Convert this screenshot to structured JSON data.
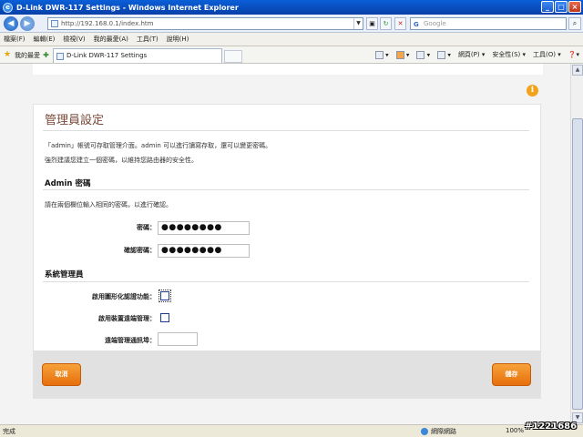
{
  "window": {
    "title": "D-Link DWR-117 Settings - Windows Internet Explorer"
  },
  "addressbar": {
    "url": "http://192.168.0.1/index.htm",
    "search_placeholder": "Google"
  },
  "menu": [
    "檔案(F)",
    "編輯(E)",
    "檢視(V)",
    "我的最愛(A)",
    "工具(T)",
    "說明(H)"
  ],
  "favorites": {
    "label": "我的最愛"
  },
  "tab": {
    "title": "D-Link DWR-117 Settings"
  },
  "commandbar": {
    "page": "網頁(P)",
    "safety": "安全性(S)",
    "tools": "工具(O)"
  },
  "page": {
    "title": "管理員設定",
    "desc1": "「admin」帳號可存取管理介面。admin 可以進行讀寫存取，還可以變更密碼。",
    "desc2": "強烈建議您建立一個密碼，以維持您路由器的安全性。",
    "admin_section": {
      "title": "Admin 密碼",
      "instruction": "請在兩個欄位輸入相同的密碼，以進行確認。",
      "password_label": "密碼：",
      "password_value": "●●●●●●●●",
      "confirm_label": "確認密碼：",
      "confirm_value": "●●●●●●●●"
    },
    "system_section": {
      "title": "系統管理員",
      "captcha_label": "啟用圖形化認證功能：",
      "captcha_checked": false,
      "remote_label": "啟用裝置遠端管理：",
      "remote_checked": false,
      "port_label": "遠端管理通訊埠：",
      "port_value": ""
    },
    "buttons": {
      "cancel": "取消",
      "save": "儲存"
    }
  },
  "statusbar": {
    "status": "完成",
    "zone": "網際網路",
    "zoom": "100%"
  },
  "watermark": "#1221686",
  "colors": {
    "title": "#7b4a3a",
    "button": "#f08a1c",
    "info_icon": "#f2a21b"
  }
}
